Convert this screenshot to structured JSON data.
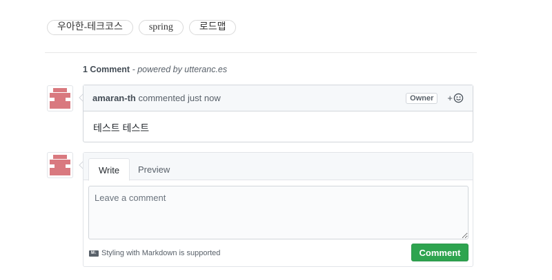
{
  "tags": [
    "우아한-테크코스",
    "spring",
    "로드맵"
  ],
  "comments_meta": {
    "count_label": "1 Comment",
    "powered_by": "- powered by utteranc.es"
  },
  "comment": {
    "author": "amaran-th",
    "action": "commented just now",
    "badge": "Owner",
    "reaction_plus": "+",
    "body": "테스트 테스트"
  },
  "form": {
    "tabs": [
      "Write",
      "Preview"
    ],
    "placeholder": "Leave a comment",
    "markdown_note": "Styling with Markdown is supported",
    "markdown_icon": "M↓",
    "submit_label": "Comment"
  },
  "colors": {
    "avatar": "#d9797f",
    "submit": "#2ea44f"
  }
}
